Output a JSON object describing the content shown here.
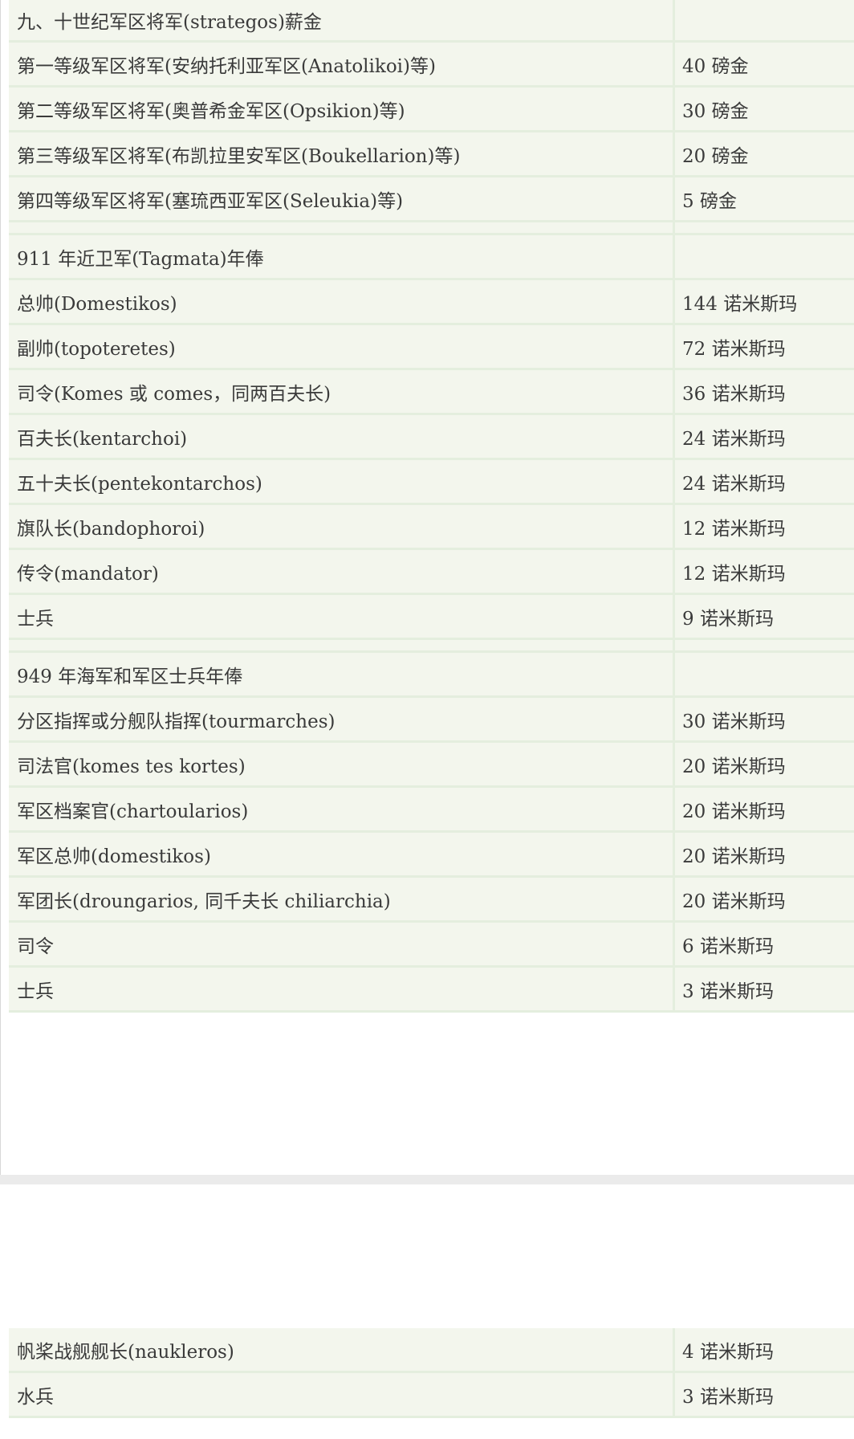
{
  "sections": [
    {
      "heading": "九、十世纪军区将军(strategos)薪金",
      "rows": [
        {
          "role": "第一等级军区将军(安纳托利亚军区(Anatolikoi)等)",
          "pay": "40 磅金"
        },
        {
          "role": "第二等级军区将军(奥普希金军区(Opsikion)等)",
          "pay": "30 磅金"
        },
        {
          "role": "第三等级军区将军(布凯拉里安军区(Boukellarion)等)",
          "pay": "20 磅金"
        },
        {
          "role": "第四等级军区将军(塞琉西亚军区(Seleukia)等)",
          "pay": "5 磅金"
        }
      ]
    },
    {
      "heading": "911 年近卫军(Tagmata)年俸",
      "rows": [
        {
          "role": "总帅(Domestikos)",
          "pay": "144 诺米斯玛"
        },
        {
          "role": "副帅(topoteretes)",
          "pay": "72 诺米斯玛"
        },
        {
          "role": "司令(Komes 或 comes，同两百夫长)",
          "pay": "36 诺米斯玛"
        },
        {
          "role": "百夫长(kentarchoi)",
          "pay": "24 诺米斯玛"
        },
        {
          "role": "五十夫长(pentekontarchos)",
          "pay": "24 诺米斯玛"
        },
        {
          "role": "旗队长(bandophoroi)",
          "pay": "12 诺米斯玛"
        },
        {
          "role": "传令(mandator)",
          "pay": "12 诺米斯玛"
        },
        {
          "role": "士兵",
          "pay": "9 诺米斯玛"
        }
      ]
    },
    {
      "heading": "949 年海军和军区士兵年俸",
      "rows": [
        {
          "role": "分区指挥或分舰队指挥(tourmarches)",
          "pay": "30 诺米斯玛"
        },
        {
          "role": "司法官(komes tes kortes)",
          "pay": "20 诺米斯玛"
        },
        {
          "role": "军区档案官(chartoularios)",
          "pay": "20 诺米斯玛"
        },
        {
          "role": "军区总帅(domestikos)",
          "pay": "20 诺米斯玛"
        },
        {
          "role": "军团长(droungarios, 同千夫长 chiliarchia)",
          "pay": "20 诺米斯玛"
        },
        {
          "role": "司令",
          "pay": "6 诺米斯玛"
        },
        {
          "role": "士兵",
          "pay": "3 诺米斯玛"
        }
      ]
    }
  ],
  "continuation": {
    "rows": [
      {
        "role": "帆桨战舰舰长(naukleros)",
        "pay": "4 诺米斯玛"
      },
      {
        "role": "水兵",
        "pay": "3 诺米斯玛"
      }
    ]
  }
}
